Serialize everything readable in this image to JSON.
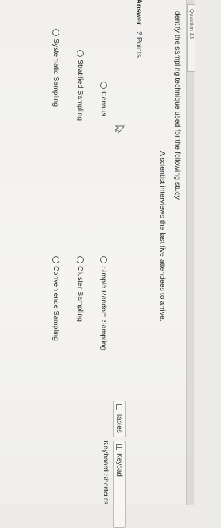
{
  "header": {
    "question_tab": "Question 13"
  },
  "question": {
    "prompt": "Identify the sampling technique used for the following study.",
    "scenario": "A scientist interviews the last five attendees to arrive."
  },
  "answer": {
    "label": "Answer",
    "points": "2 Points"
  },
  "options": [
    {
      "label": "Census"
    },
    {
      "label": "Stratified Sampling"
    },
    {
      "label": "Systematic Sampling"
    },
    {
      "label": "Simple Random Sampling"
    },
    {
      "label": "Cluster Sampling"
    },
    {
      "label": "Convenience Sampling"
    }
  ],
  "tools": {
    "tables_label": "Tables",
    "keypad_label": "Keypad",
    "keyboard_shortcuts_label": "Keyboard Shortcuts"
  },
  "icons": [
    "table-grid-icon",
    "keypad-grid-icon",
    "mouse-cursor-icon",
    "radio-circle-icon"
  ],
  "colors": {
    "text": "#2f3236",
    "background": "#f3f2ef",
    "border": "#bdbcb8"
  }
}
